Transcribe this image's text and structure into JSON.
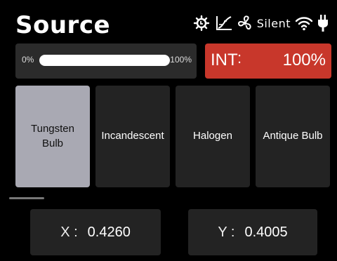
{
  "header": {
    "title": "Source",
    "silent_label": "Silent",
    "icons": [
      "fan-dial-icon",
      "curve-chart-icon",
      "fan-icon",
      "wifi-icon",
      "plug-icon"
    ]
  },
  "slider": {
    "min_label": "0%",
    "max_label": "100%",
    "value_fraction": 1.0
  },
  "intensity": {
    "label": "INT",
    "separator": ":",
    "value": "100%",
    "color": "#c8372b"
  },
  "sources": [
    {
      "label": "Tungsten Bulb",
      "selected": true
    },
    {
      "label": "Incandescent",
      "selected": false
    },
    {
      "label": "Halogen",
      "selected": false
    },
    {
      "label": "Antique Bulb",
      "selected": false
    }
  ],
  "coords": {
    "x_label": "X :",
    "x_value": "0.4260",
    "y_label": "Y :",
    "y_value": "0.4005"
  }
}
